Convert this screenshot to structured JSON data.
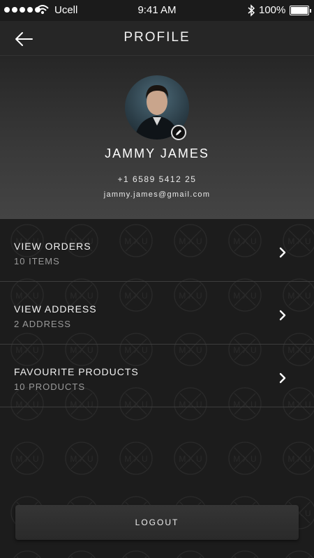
{
  "status_bar": {
    "carrier": "Ucell",
    "time": "9:41 AM",
    "battery": "100%"
  },
  "header": {
    "title": "PROFILE",
    "back_icon": "arrow-left-icon"
  },
  "profile": {
    "name": "JAMMY JAMES",
    "phone": "+1 6589 5412 25",
    "email": "jammy.james@gmail.com",
    "edit_icon": "pencil-icon"
  },
  "menu": {
    "items": [
      {
        "label": "VIEW ORDERS",
        "sub": "10 ITEMS"
      },
      {
        "label": "VIEW ADDRESS",
        "sub": "2 ADDRESS"
      },
      {
        "label": "FAVOURITE PRODUCTS",
        "sub": "10 PRODUCTS"
      }
    ]
  },
  "logout_label": "LOGOUT",
  "pattern_text": "MXU",
  "colors": {
    "background": "#1b1b1b",
    "header": "#262626",
    "text": "#ffffff",
    "subtext": "#9a9a9a"
  }
}
